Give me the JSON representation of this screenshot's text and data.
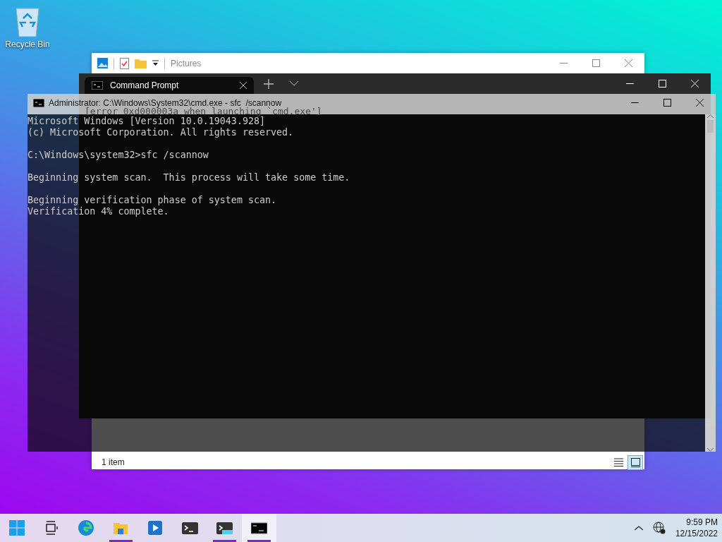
{
  "desktop_icons": [
    {
      "label": "Recycle Bin"
    }
  ],
  "explorer": {
    "location": "Pictures",
    "status": "1 item",
    "views": [
      {
        "kind": "details",
        "selected": false
      },
      {
        "kind": "large-icons",
        "selected": true
      }
    ]
  },
  "terminal": {
    "tabs": [
      {
        "title": "Command Prompt",
        "selected": true
      }
    ],
    "message": "[error 0xd000003a when launching `cmd.exe']"
  },
  "console": {
    "title": "Administrator: C:\\Windows\\System32\\cmd.exe - sfc  /scannow",
    "blocks": [
      {
        "lines": [
          "Microsoft Windows [Version 10.0.19043.928]",
          "(c) Microsoft Corporation. All rights reserved."
        ]
      },
      {
        "lines": [
          "C:\\Windows\\system32>sfc /scannow"
        ]
      },
      {
        "lines": [
          "Beginning system scan.  This process will take some time."
        ]
      },
      {
        "lines": [
          "Beginning verification phase of system scan.",
          "Verification 4% complete."
        ]
      }
    ]
  },
  "taskbar": {
    "apps": [
      {
        "kind": "start",
        "running": false,
        "active": false
      },
      {
        "kind": "task-view",
        "running": false,
        "active": false
      },
      {
        "kind": "edge",
        "running": false,
        "active": false
      },
      {
        "kind": "file-explorer",
        "running": true,
        "active": false
      },
      {
        "kind": "media",
        "running": false,
        "active": false
      },
      {
        "kind": "terminal",
        "running": false,
        "active": false
      },
      {
        "kind": "terminal-preview",
        "running": true,
        "active": false
      },
      {
        "kind": "cmd",
        "running": true,
        "active": true
      }
    ],
    "time": "9:59 PM",
    "date": "12/15/2022"
  }
}
